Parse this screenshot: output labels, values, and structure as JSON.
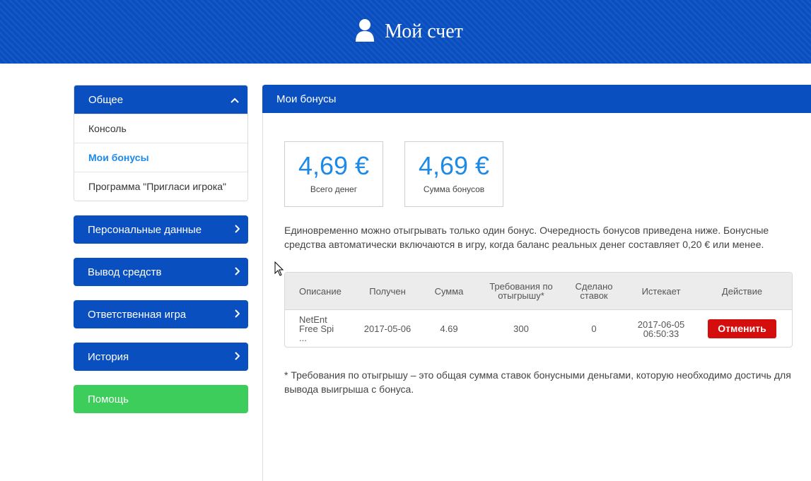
{
  "header": {
    "title": "Мой счет",
    "icon": "user-icon"
  },
  "sidebar": {
    "group": {
      "title": "Общее",
      "items": [
        {
          "label": "Консоль"
        },
        {
          "label": "Мои бонусы"
        },
        {
          "label": "Программа \"Пригласи игрока\""
        }
      ]
    },
    "nav": [
      {
        "label": "Персональные данные"
      },
      {
        "label": "Вывод средств"
      },
      {
        "label": "Ответственная игра"
      },
      {
        "label": "История"
      },
      {
        "label": "Помощь"
      }
    ]
  },
  "main": {
    "title": "Мои бонусы",
    "stats": [
      {
        "value": "4,69 €",
        "label": "Всего денег"
      },
      {
        "value": "4,69 €",
        "label": "Сумма бонусов"
      }
    ],
    "notice": "Единовременно можно отыгрывать только один бонус. Очередность бонусов приведена ниже. Бонусные средства автоматически включаются в игру, когда баланс реальных денег составляет 0,20 € или менее.",
    "table": {
      "headers": [
        "Описание",
        "Получен",
        "Сумма",
        "Требования по отыгрышу*",
        "Сделано ставок",
        "Истекает",
        "Действие"
      ],
      "rows": [
        {
          "description_line1": "NetEnt",
          "description_line2": "Free Spi ...",
          "received": "2017-05-06",
          "amount": "4.69",
          "wagering": "300",
          "bets_made": "0",
          "expires_date": "2017-06-05",
          "expires_time": "06:50:33",
          "action": "Отменить"
        }
      ]
    },
    "footnote": "* Требования по отыгрышу – это общая сумма ставок бонусными деньгами, которую необходимо достичь для вывода выигрыша с бонуса."
  },
  "colors": {
    "primary": "#0a4fc0",
    "accent": "#1d8ae8",
    "green": "#3ccd5a",
    "danger": "#d40d0d"
  }
}
